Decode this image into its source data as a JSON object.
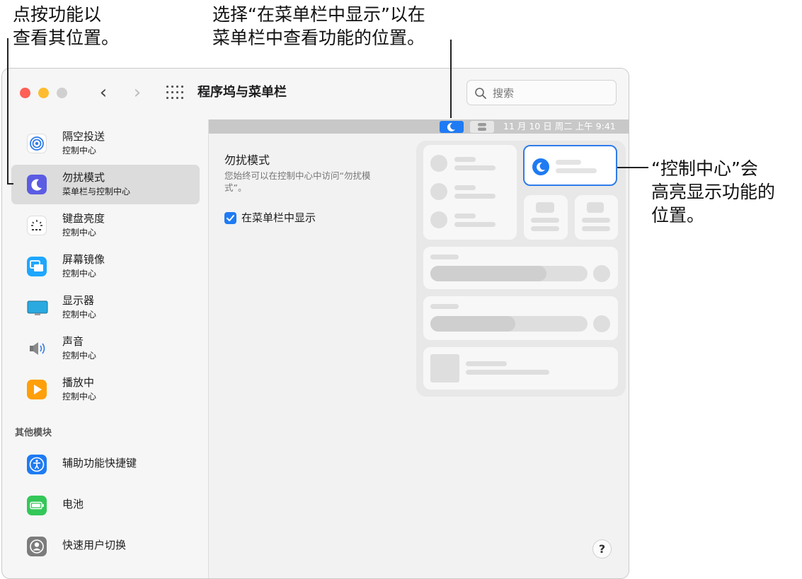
{
  "annotations": {
    "top_left": [
      "点按功能以",
      "查看其位置。"
    ],
    "top_center": [
      "选择“在菜单栏中显示”以在",
      "菜单栏中查看功能的位置。"
    ],
    "right": [
      "“控制中心”会",
      "高亮显示功能的",
      "位置。"
    ]
  },
  "window": {
    "title": "程序坞与菜单栏",
    "search_placeholder": "搜索"
  },
  "sidebar": {
    "items": [
      {
        "label": "隔空投送",
        "sub": "控制中心",
        "icon": "airdrop-icon"
      },
      {
        "label": "勿扰模式",
        "sub": "菜单栏与控制中心",
        "icon": "moon-icon",
        "selected": true
      },
      {
        "label": "键盘亮度",
        "sub": "控制中心",
        "icon": "keyboard-brightness-icon"
      },
      {
        "label": "屏幕镜像",
        "sub": "控制中心",
        "icon": "screen-mirroring-icon"
      },
      {
        "label": "显示器",
        "sub": "控制中心",
        "icon": "display-icon"
      },
      {
        "label": "声音",
        "sub": "控制中心",
        "icon": "speaker-icon"
      },
      {
        "label": "播放中",
        "sub": "控制中心",
        "icon": "play-icon"
      }
    ],
    "section": "其他模块",
    "other": [
      {
        "label": "辅助功能快捷键",
        "icon": "accessibility-icon"
      },
      {
        "label": "电池",
        "icon": "battery-icon"
      },
      {
        "label": "快速用户切换",
        "icon": "user-switch-icon"
      }
    ]
  },
  "menubar": {
    "datetime": "11 月 10 日 周二  上午 9:41"
  },
  "detail": {
    "title": "勿扰模式",
    "description": "您始终可以在控制中心中访问“勿扰模式”。",
    "checkbox_label": "在菜单栏中显示",
    "checkbox_checked": true
  },
  "help_label": "?",
  "colors": {
    "accent": "#1f7bf3",
    "highlight_border": "#2f7bea",
    "close": "#ff5f57",
    "minimize": "#febc2e"
  }
}
